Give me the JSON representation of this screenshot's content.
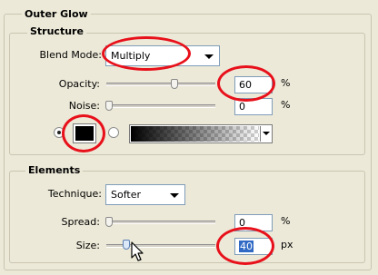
{
  "outer_glow": {
    "title": "Outer Glow",
    "structure": {
      "title": "Structure",
      "blend_mode_label": "Blend Mode:",
      "blend_mode_value": "Multiply",
      "opacity_label": "Opacity:",
      "opacity_value": "60",
      "opacity_fraction": 0.6,
      "noise_label": "Noise:",
      "noise_value": "0",
      "percent": "%",
      "color_swatch": "#000000",
      "color_radio_selected": true,
      "gradient_radio_selected": false
    },
    "elements": {
      "title": "Elements",
      "technique_label": "Technique:",
      "technique_value": "Softer",
      "spread_label": "Spread:",
      "spread_value": "0",
      "spread_fraction": 0,
      "size_label": "Size:",
      "size_value": "40",
      "size_fraction": 0.16,
      "percent": "%",
      "px": "px"
    },
    "highlight_color": "#e8101a"
  }
}
